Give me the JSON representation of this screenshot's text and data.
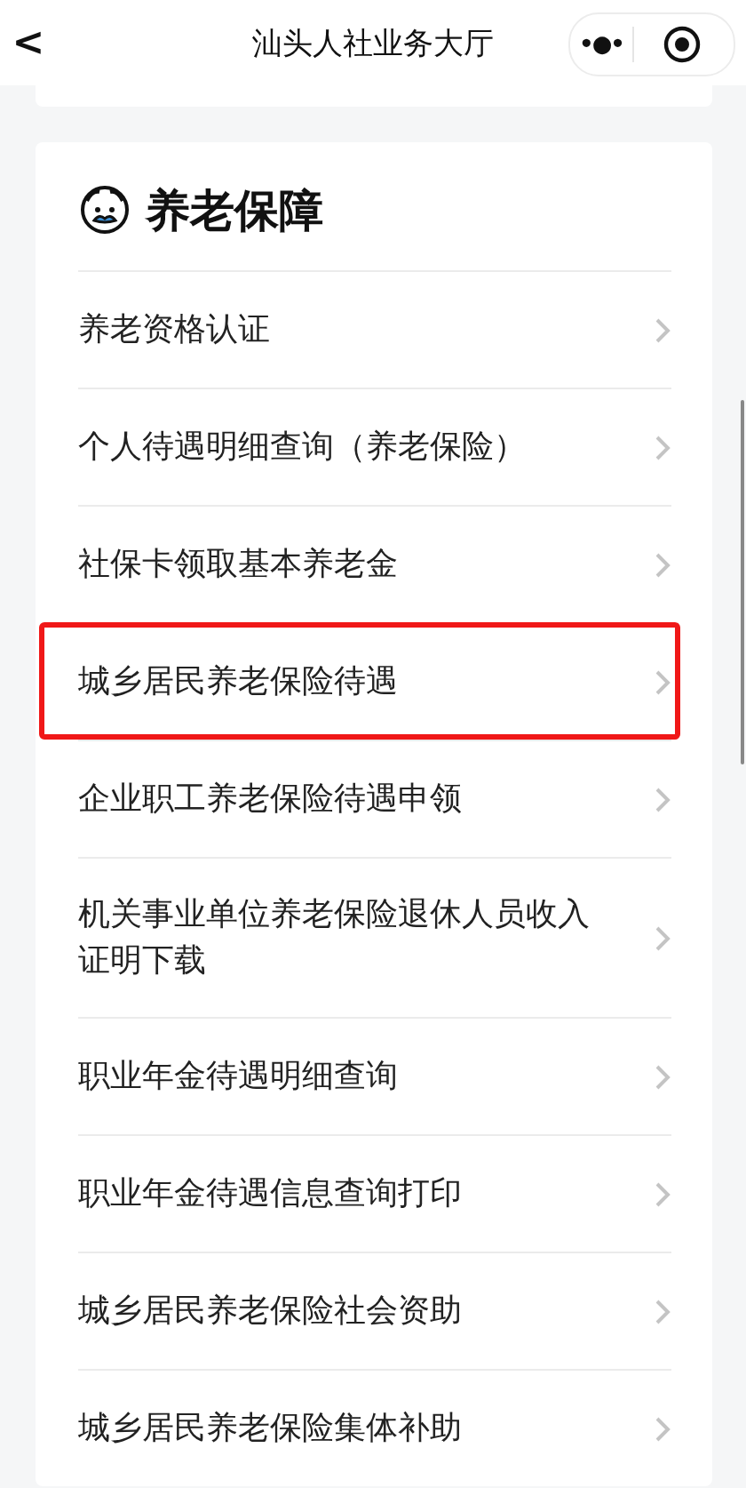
{
  "nav_bar": {
    "back": "<",
    "title": "汕头人社业务大厅",
    "more": "•●•"
  },
  "section": {
    "title": "养老保障",
    "items": [
      {
        "label": "养老资格认证",
        "highlighted": false
      },
      {
        "label": "个人待遇明细查询（养老保险）",
        "highlighted": false
      },
      {
        "label": "社保卡领取基本养老金",
        "highlighted": false
      },
      {
        "label": "城乡居民养老保险待遇",
        "highlighted": true
      },
      {
        "label": "企业职工养老保险待遇申领",
        "highlighted": false
      },
      {
        "label": "机关事业单位养老保险退休人员收入证明下载",
        "highlighted": false
      },
      {
        "label": "职业年金待遇明细查询",
        "highlighted": false
      },
      {
        "label": "职业年金待遇信息查询打印",
        "highlighted": false
      },
      {
        "label": "城乡居民养老保险社会资助",
        "highlighted": false
      },
      {
        "label": "城乡居民养老保险集体补助",
        "highlighted": false
      }
    ]
  }
}
